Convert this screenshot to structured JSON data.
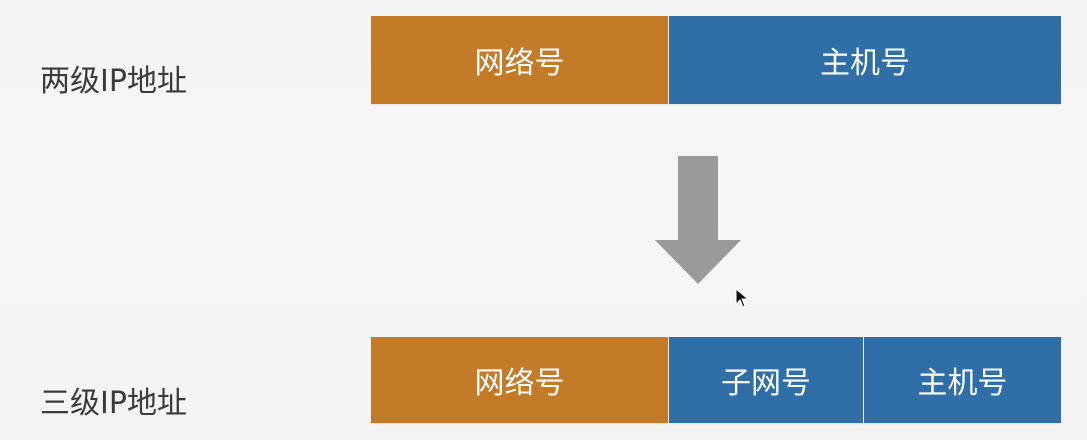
{
  "labels": {
    "two_level": "两级IP地址",
    "three_level": "三级IP地址"
  },
  "two_level_bar": {
    "network": "网络号",
    "host": "主机号"
  },
  "three_level_bar": {
    "network": "网络号",
    "subnet": "子网号",
    "host": "主机号"
  },
  "colors": {
    "network": "#c47b27",
    "host": "#2f6ea6",
    "arrow": "#9a9a9a",
    "text": "#3a3a3a"
  },
  "icons": {
    "transition_arrow": "down-arrow-icon",
    "mouse_cursor": "cursor-icon"
  }
}
